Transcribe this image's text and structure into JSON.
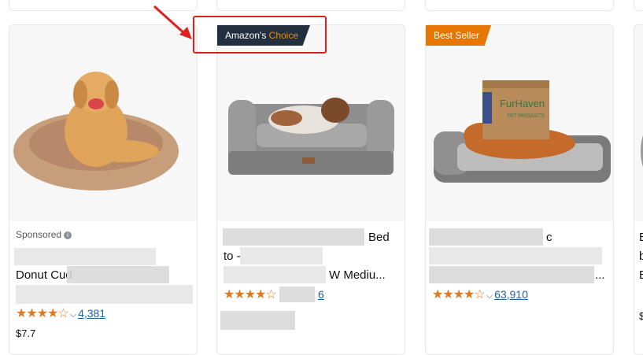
{
  "products": [
    {
      "sponsored_label": "Sponsored",
      "title_lines": [
        "",
        "Donut Cud",
        "",
        ""
      ],
      "stars": "★★★★☆",
      "rating_count": "4,381",
      "price_partial": "$7.7"
    },
    {
      "badge": {
        "prefix": "Amazon's",
        "emphasis": "Choice"
      },
      "title_lines": [
        "Bed",
        "to -",
        "W Mediu..."
      ],
      "stars": "★★★★☆",
      "rating_count": "6"
    },
    {
      "badge": {
        "text": "Best Seller"
      },
      "title_lines": [
        "c",
        "",
        "..."
      ],
      "stars": "★★★★☆",
      "rating_count": "63,910"
    },
    {
      "title_lines": [
        "E",
        "b",
        "E"
      ],
      "price_partial": "$"
    }
  ],
  "colors": {
    "amazon_choice_bg": "#232f3e",
    "amazon_choice_accent": "#f08804",
    "best_seller_bg": "#e77600",
    "star": "#de7921",
    "link": "#2162a1",
    "highlight_box": "#e0201c",
    "annotation_arrow": "#e0201c"
  }
}
